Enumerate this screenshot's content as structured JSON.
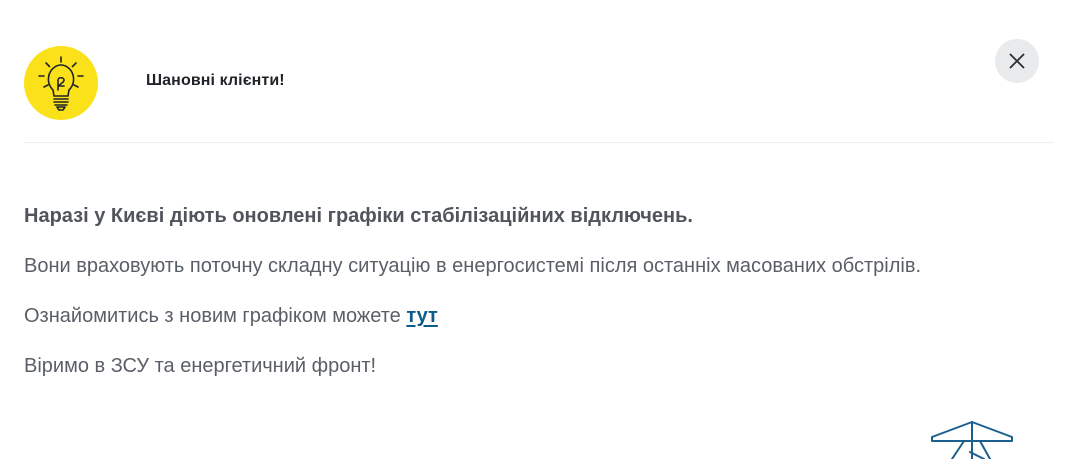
{
  "header": {
    "title": "Шановні клієнти!",
    "icon": "lightbulb-icon",
    "icon_bg_color": "#fbe11a",
    "close_icon": "close-icon"
  },
  "message": {
    "lead": "Наразі у Києві діють оновлені графіки стабілізаційних відключень.",
    "line2": "Вони враховують поточну складну ситуацію в енергосистемі після останніх масованих обстрілів.",
    "line3_prefix": "Ознайомитись з новим графіком можете ",
    "line3_link": "тут",
    "line4": "Віримо в ЗСУ та енергетичний фронт!"
  },
  "colors": {
    "link": "#0d5c8a",
    "text": "#5a5f67",
    "accent_yellow": "#fbe11a"
  },
  "decoration": {
    "icon": "power-pylon-icon"
  }
}
